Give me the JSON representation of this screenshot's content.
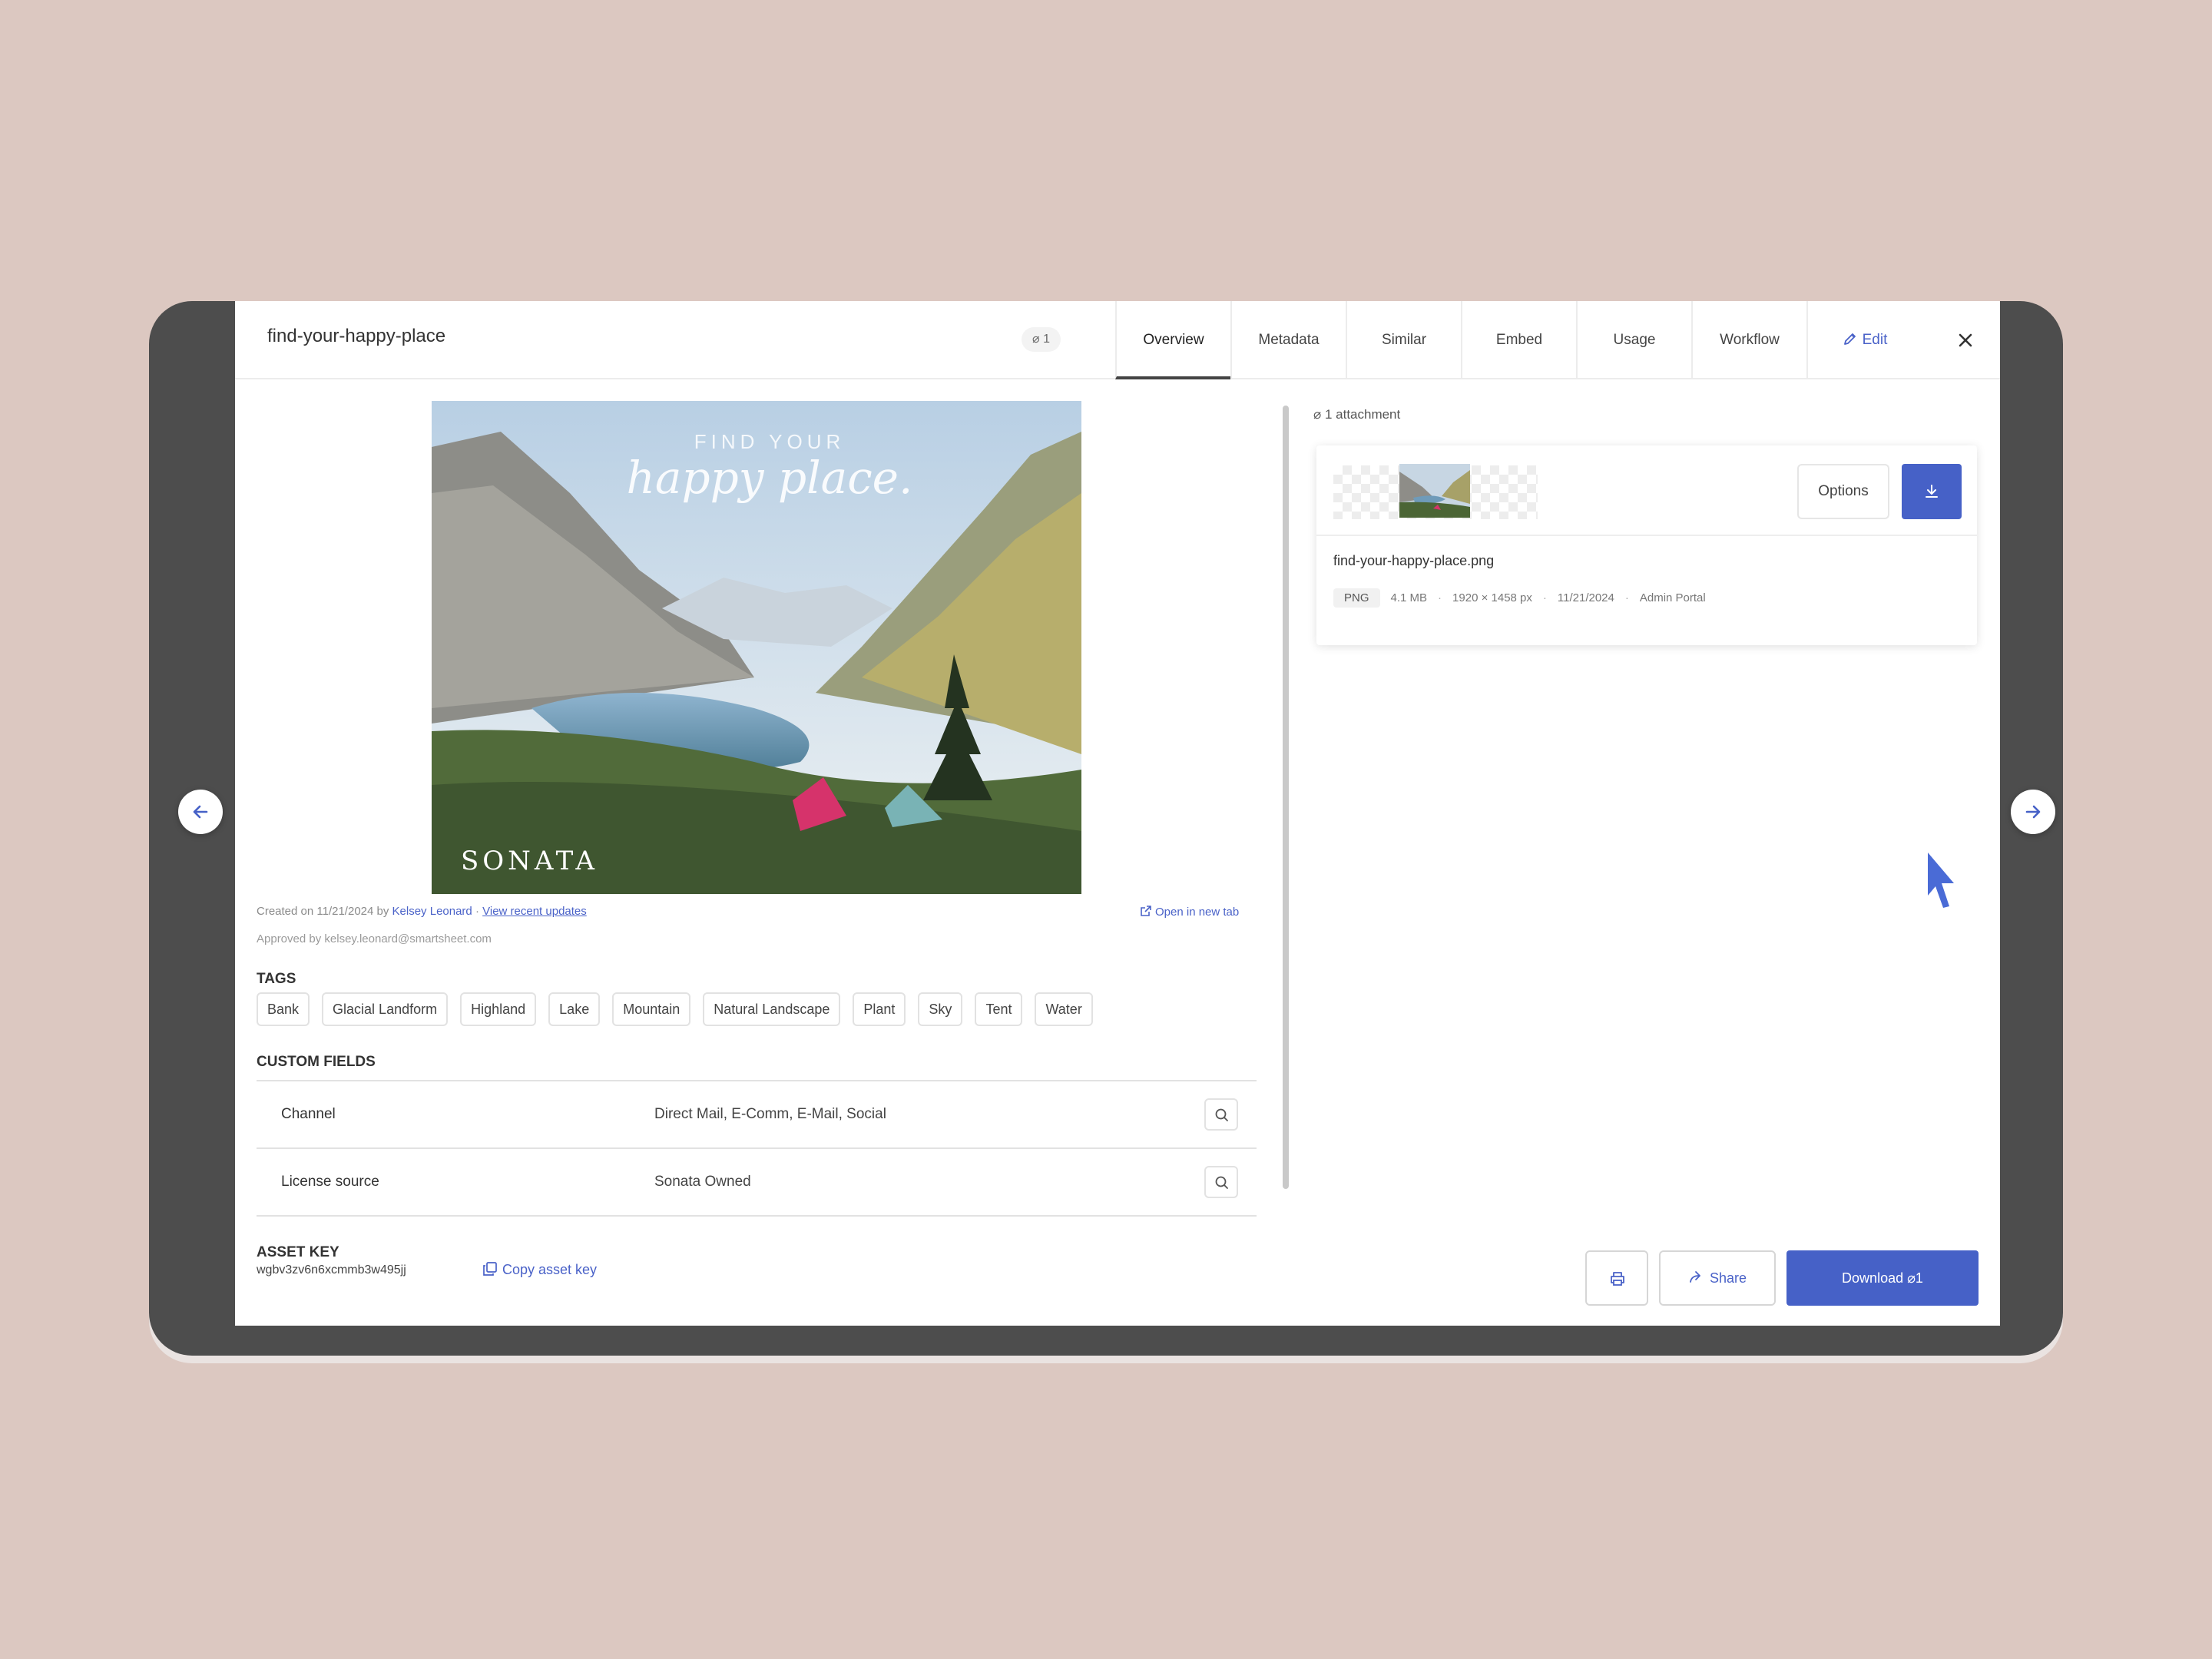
{
  "header": {
    "title": "find-your-happy-place",
    "attachment_badge": "⌀ 1",
    "tabs": [
      "Overview",
      "Metadata",
      "Similar",
      "Embed",
      "Usage",
      "Workflow",
      "Edit"
    ]
  },
  "preview": {
    "overlay_line1": "FIND YOUR",
    "overlay_line2": "happy place.",
    "watermark": "SONATA"
  },
  "meta": {
    "created_prefix": "Created on 11/21/2024 by",
    "author": "Kelsey Leonard",
    "separator": "·",
    "recent_updates": "View recent updates",
    "approved": "Approved by kelsey.leonard@smartsheet.com",
    "open_new_tab": "Open in new tab"
  },
  "tags": {
    "heading": "TAGS",
    "items": [
      "Bank",
      "Glacial Landform",
      "Highland",
      "Lake",
      "Mountain",
      "Natural Landscape",
      "Plant",
      "Sky",
      "Tent",
      "Water"
    ]
  },
  "custom_fields": {
    "heading": "CUSTOM FIELDS",
    "rows": [
      {
        "label": "Channel",
        "value": "Direct Mail, E-Comm, E-Mail, Social"
      },
      {
        "label": "License source",
        "value": "Sonata Owned"
      }
    ]
  },
  "asset_key": {
    "heading": "ASSET KEY",
    "value": "wgbv3zv6n6xcmmb3w495jj",
    "copy_label": "Copy asset key"
  },
  "attachments": {
    "count_label": "⌀ 1 attachment",
    "options_label": "Options",
    "file_name": "find-your-happy-place.png",
    "file_type": "PNG",
    "file_size": "4.1 MB",
    "dimensions": "1920 × 1458 px",
    "date": "11/21/2024",
    "source": "Admin Portal"
  },
  "footer": {
    "share_label": "Share",
    "download_label": "Download ⌀1"
  },
  "colors": {
    "accent": "#4661c7",
    "background": "#dcc8c1",
    "frame": "#4d4d4d"
  }
}
